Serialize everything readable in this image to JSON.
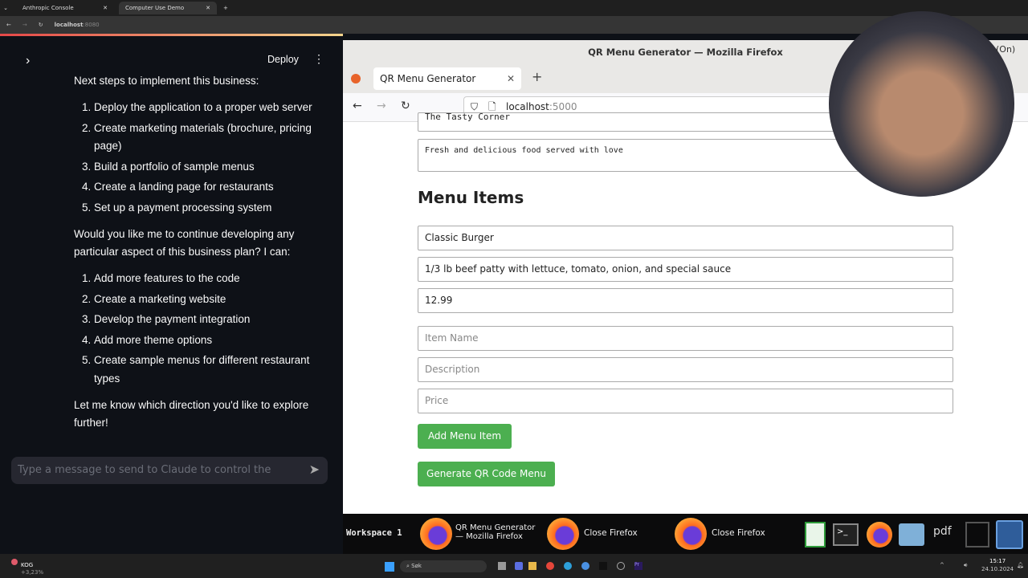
{
  "chrome": {
    "tabs": [
      {
        "label": "Anthropic Console"
      },
      {
        "label": "Computer Use Demo"
      }
    ],
    "url_host": "localhost",
    "url_port": ":8080"
  },
  "streamlit": {
    "deploy": "Deploy",
    "intro": "Next steps to implement this business:",
    "steps": [
      "Deploy the application to a proper web server",
      "Create marketing materials (brochure, pricing page)",
      "Build a portfolio of sample menus",
      "Create a landing page for restaurants",
      "Set up a payment processing system"
    ],
    "question": "Would you like me to continue developing any particular aspect of this business plan? I can:",
    "options": [
      "Add more features to the code",
      "Create a marketing website",
      "Develop the payment integration",
      "Add more theme options",
      "Create sample menus for different restaurant types"
    ],
    "closing": "Let me know which direction you'd like to explore further!",
    "input_placeholder": "Type a message to send to Claude to control the"
  },
  "firefox": {
    "window_title": "QR Menu Generator — Mozilla Firefox",
    "tab": "QR Menu Generator",
    "url_host": "localhost",
    "url_port": ":5000",
    "restaurant_name": "The Tasty Corner",
    "restaurant_description": "Fresh and delicious food served with love",
    "menu_heading": "Menu Items",
    "item": {
      "name": "Classic Burger",
      "description": "1/3 lb beef patty with lettuce, tomato, onion, and special sauce",
      "price": "12.99"
    },
    "placeholders": {
      "name": "Item Name",
      "description": "Description",
      "price": "Price"
    },
    "add_button": "Add Menu Item",
    "generate_button": "Generate QR Code Menu",
    "status_partial": "(On)"
  },
  "taskbar": {
    "workspace": "Workspace 1",
    "items": [
      "QR Menu Generator — Mozilla Firefox",
      "Close Firefox",
      "Close Firefox"
    ]
  },
  "windows": {
    "stock": "KOG",
    "stock_change": "+3,23%",
    "search": "Søk",
    "time": "15:17",
    "date": "24.10.2024"
  },
  "colors": {
    "accent_green": "#4caf50",
    "streamlit_bg": "#0e1117"
  }
}
